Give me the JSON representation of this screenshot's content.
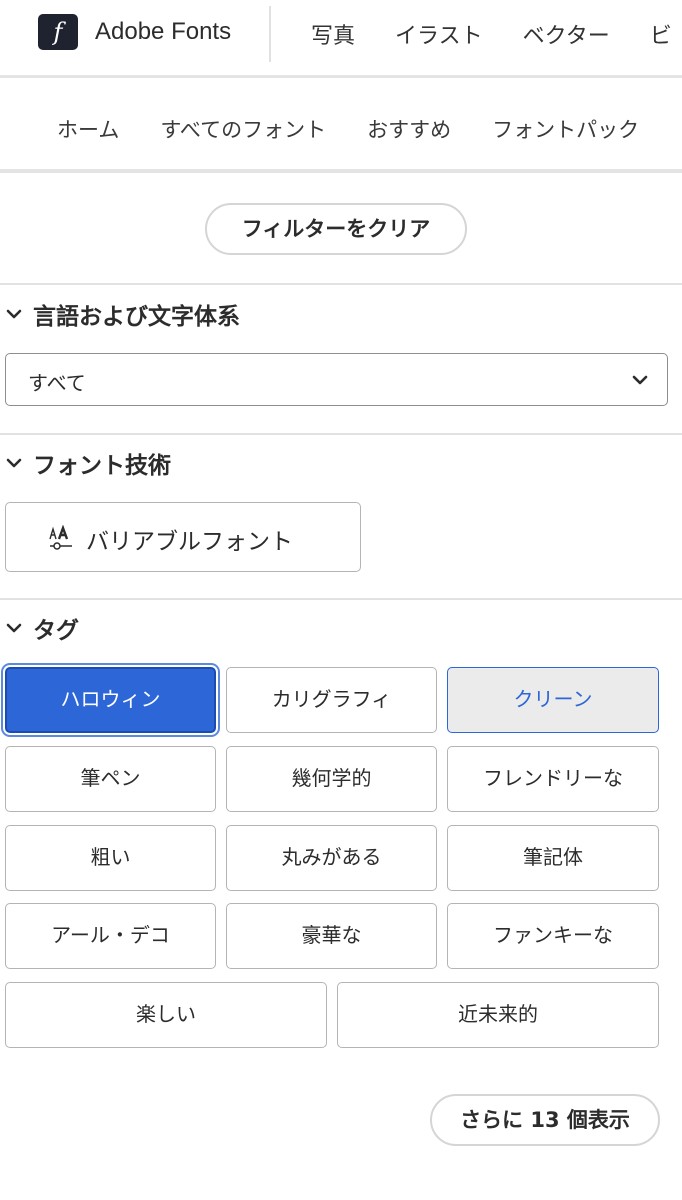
{
  "header": {
    "brand": "Adobe Fonts",
    "logo_glyph": "f",
    "nav": [
      "写真",
      "イラスト",
      "ベクター",
      "ビ"
    ]
  },
  "subnav": {
    "items": [
      "ホーム",
      "すべてのフォント",
      "おすすめ",
      "フォントパック"
    ]
  },
  "filters": {
    "clear_label": "フィルターをクリア",
    "language": {
      "title": "言語および文字体系",
      "selected": "すべて"
    },
    "technology": {
      "title": "フォント技術",
      "variable_label": "バリアブルフォント",
      "variable_icon": "variable-font-icon"
    },
    "tags": {
      "title": "タグ",
      "items": [
        "ハロウィン",
        "カリグラフィ",
        "クリーン",
        "筆ペン",
        "幾何学的",
        "フレンドリーな",
        "粗い",
        "丸みがある",
        "筆記体",
        "アール・デコ",
        "豪華な",
        "ファンキーな",
        "楽しい",
        "近未来的"
      ],
      "selected": "ハロウィン",
      "hovered": "クリーン"
    },
    "show_more_label": "さらに 13 個表示"
  },
  "colors": {
    "accent": "#2d66d6",
    "logo_bg": "#1f2330"
  }
}
